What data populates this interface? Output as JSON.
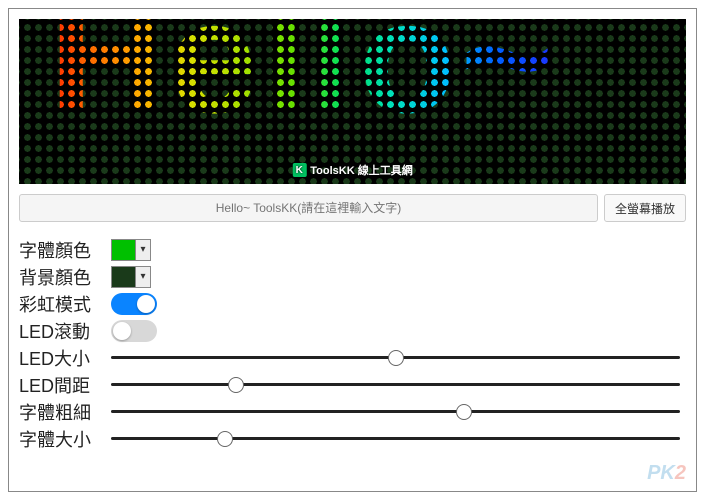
{
  "preview": {
    "display_text": "Hello~",
    "watermark": "ToolsKK 線上工具網",
    "watermark_logo_letter": "K"
  },
  "input": {
    "placeholder": "Hello~ ToolsKK(請在這裡輸入文字)",
    "fullscreen_button": "全螢幕播放"
  },
  "controls": {
    "font_color": {
      "label": "字體顏色",
      "value": "#00c000"
    },
    "bg_color": {
      "label": "背景顏色",
      "value": "#1a3a1a"
    },
    "rainbow": {
      "label": "彩虹模式",
      "on": true
    },
    "scroll": {
      "label": "LED滾動",
      "on": false
    },
    "led_size": {
      "label": "LED大小",
      "percent": 50
    },
    "led_gap": {
      "label": "LED間距",
      "percent": 22
    },
    "font_weight": {
      "label": "字體粗細",
      "percent": 62
    },
    "font_size": {
      "label": "字體大小",
      "percent": 20
    }
  },
  "corner_watermark": {
    "prefix": "PK",
    "suffix": "2"
  }
}
